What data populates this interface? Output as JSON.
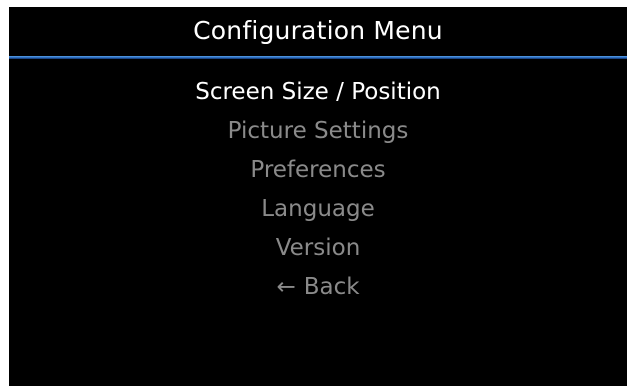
{
  "window": {
    "title": "Configuration Menu"
  },
  "menu": {
    "selected_index": 0,
    "items": [
      {
        "label": "Screen Size / Position"
      },
      {
        "label": "Picture Settings"
      },
      {
        "label": "Preferences"
      },
      {
        "label": "Language"
      },
      {
        "label": "Version"
      },
      {
        "label": "Back",
        "icon": "left-arrow-icon",
        "glyph": "←"
      }
    ]
  },
  "colors": {
    "background": "#000000",
    "selected_text": "#ffffff",
    "unselected_text": "#8a8a8a",
    "divider_accent": "#2d6fc4"
  }
}
